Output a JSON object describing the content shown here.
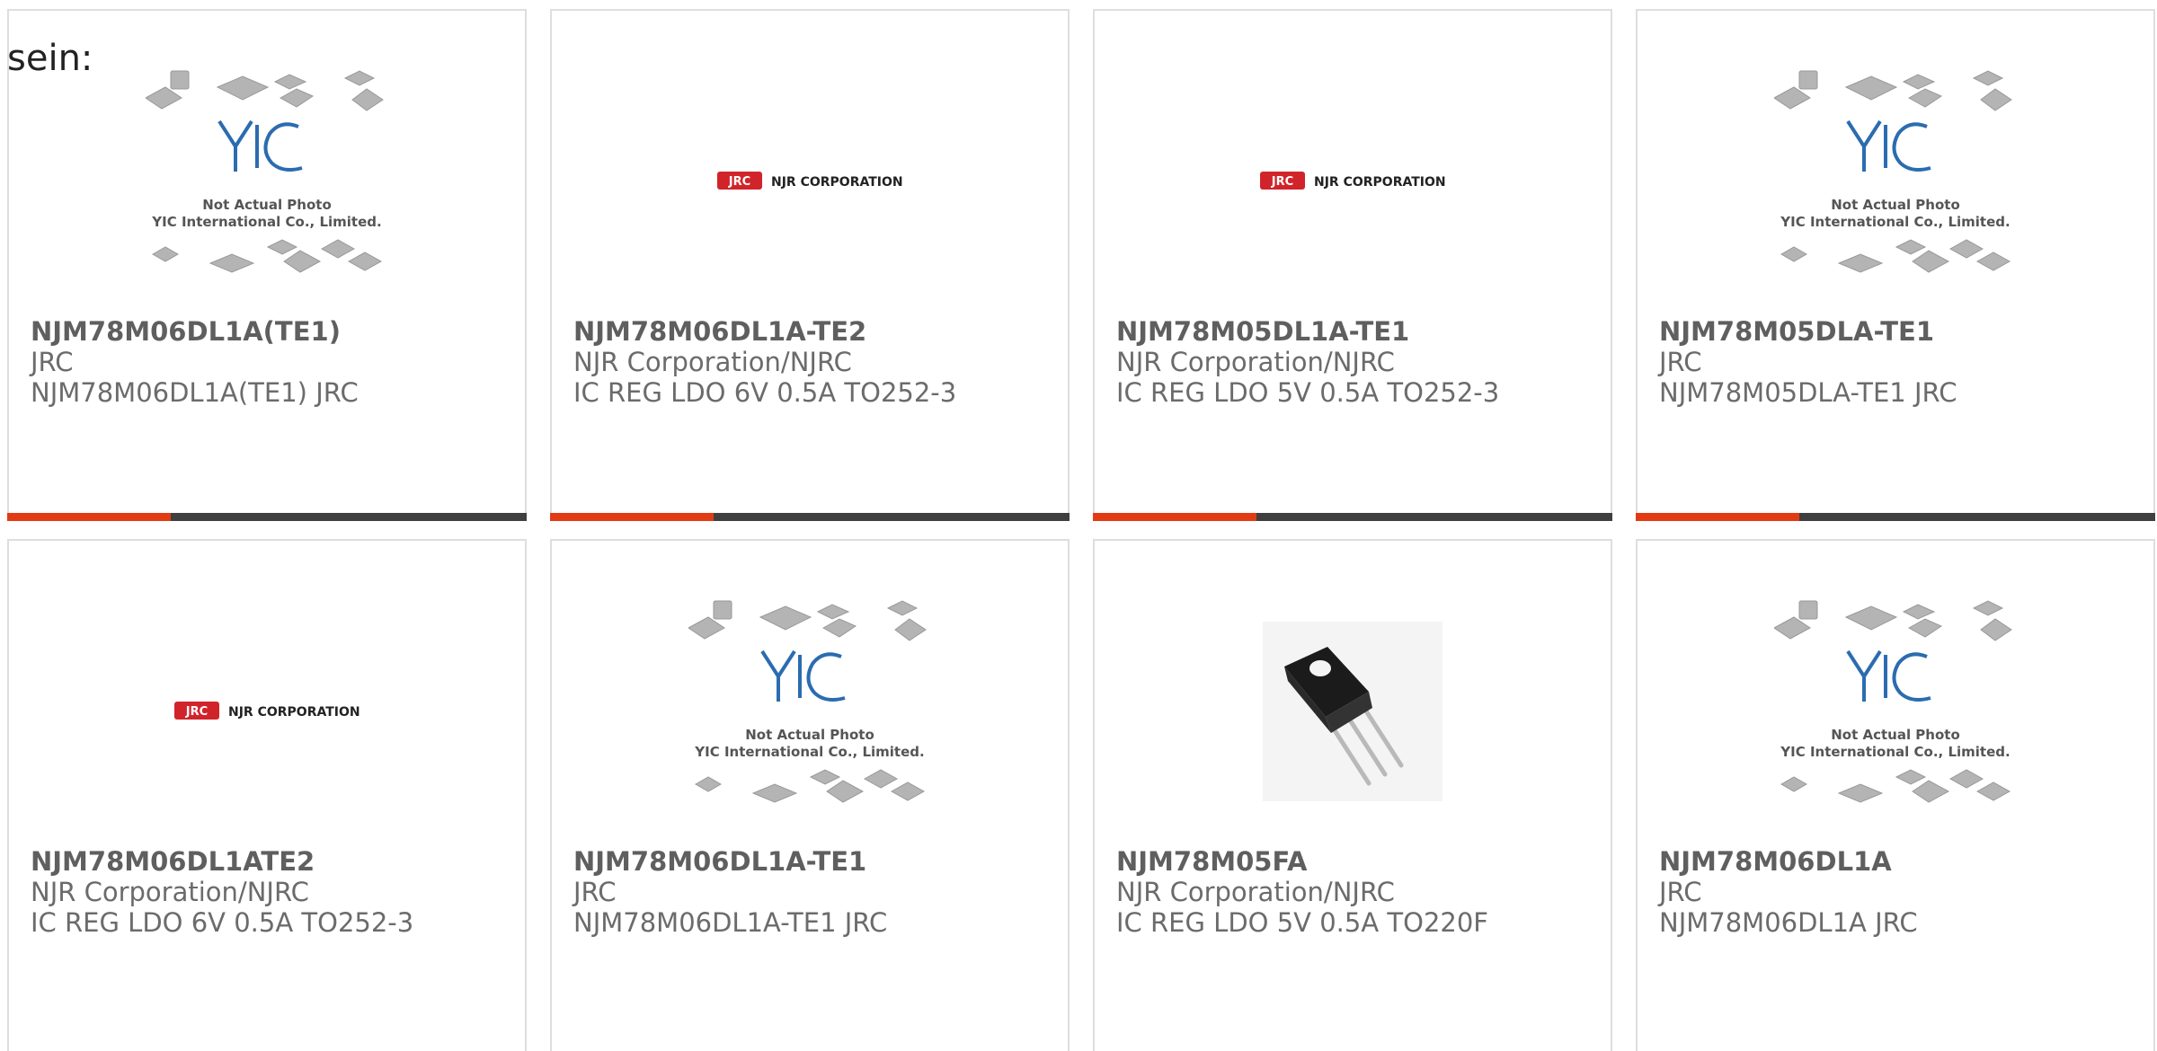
{
  "intro_text": "sein:",
  "cards": [
    {
      "part": "NJM78M06DL1A(TE1)",
      "maker": "JRC",
      "desc": "NJM78M06DL1A(TE1) JRC",
      "image": "yic-placeholder-photo",
      "placeholder": {
        "line1": "Not Actual Photo",
        "line2": "YIC International Co., Limited."
      }
    },
    {
      "part": "NJM78M06DL1A-TE2",
      "maker": "NJR Corporation/NJRC",
      "desc": "IC REG LDO 6V 0.5A TO252-3",
      "image": "njr-corporation-logo",
      "logo": {
        "badge": "JRC",
        "name": "NJR CORPORATION"
      }
    },
    {
      "part": "NJM78M05DL1A-TE1",
      "maker": "NJR Corporation/NJRC",
      "desc": "IC REG LDO 5V 0.5A TO252-3",
      "image": "njr-corporation-logo",
      "logo": {
        "badge": "JRC",
        "name": "NJR CORPORATION"
      }
    },
    {
      "part": "NJM78M05DLA-TE1",
      "maker": "JRC",
      "desc": "NJM78M05DLA-TE1 JRC",
      "image": "yic-placeholder-photo",
      "placeholder": {
        "line1": "Not Actual Photo",
        "line2": "YIC International Co., Limited."
      }
    },
    {
      "part": "NJM78M06DL1ATE2",
      "maker": "NJR Corporation/NJRC",
      "desc": "IC REG LDO 6V 0.5A TO252-3",
      "image": "njr-corporation-logo",
      "logo": {
        "badge": "JRC",
        "name": "NJR CORPORATION"
      }
    },
    {
      "part": "NJM78M06DL1A-TE1",
      "maker": "JRC",
      "desc": "NJM78M06DL1A-TE1 JRC",
      "image": "yic-placeholder-photo",
      "placeholder": {
        "line1": "Not Actual Photo",
        "line2": "YIC International Co., Limited."
      }
    },
    {
      "part": "NJM78M05FA",
      "maker": "NJR Corporation/NJRC",
      "desc": "IC REG LDO 5V 0.5A TO220F",
      "image": "to220f-package-photo"
    },
    {
      "part": "NJM78M06DL1A",
      "maker": "JRC",
      "desc": "NJM78M06DL1A JRC",
      "image": "yic-placeholder-photo",
      "placeholder": {
        "line1": "Not Actual Photo",
        "line2": "YIC International Co., Limited."
      }
    }
  ],
  "colors": {
    "accent": "#e23b14",
    "bar": "#3f3f3f",
    "border": "#dedede",
    "text": "#6b6b6b",
    "yic_blue": "#2b6cb0",
    "jrc_red": "#d1242a"
  }
}
